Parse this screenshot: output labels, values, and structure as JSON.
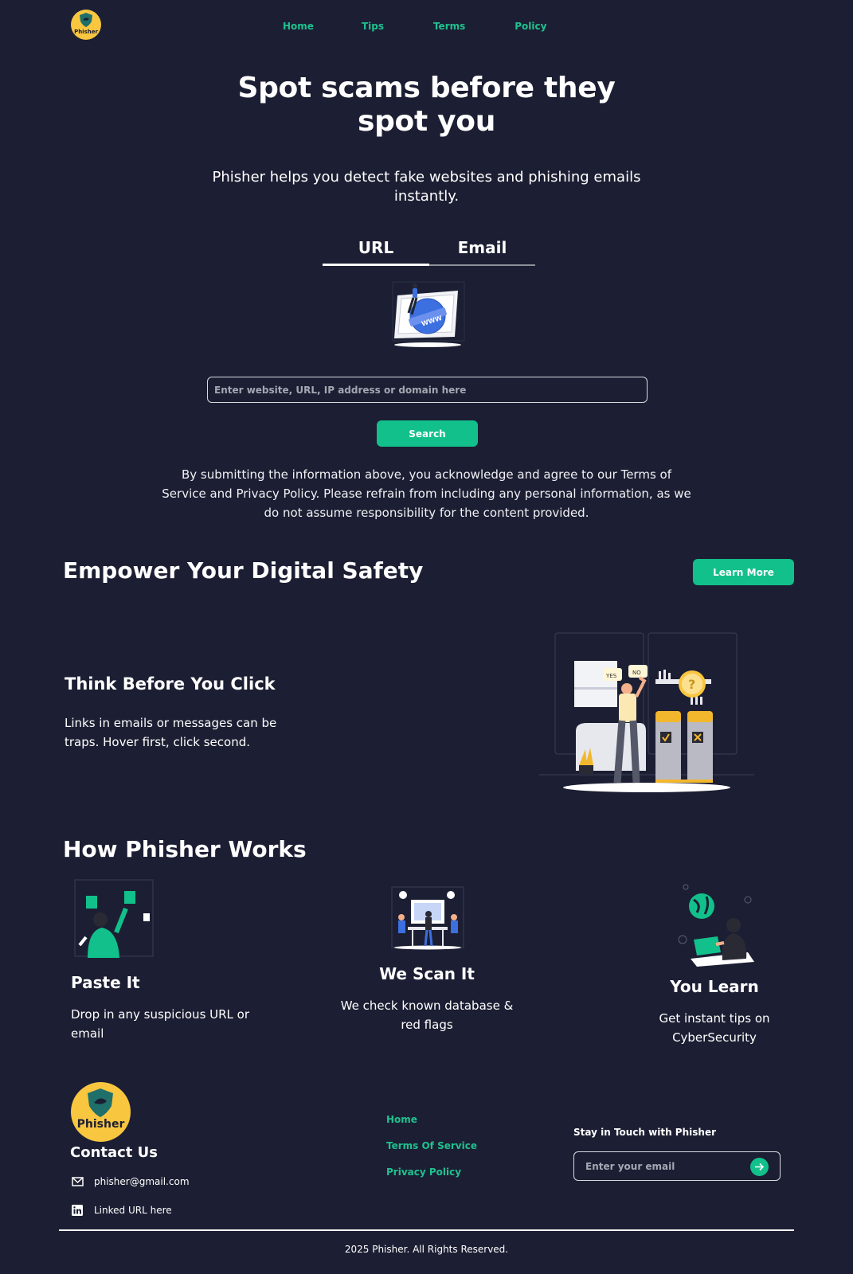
{
  "nav": {
    "logo_text": "Phisher",
    "links": [
      "Home",
      "Tips",
      "Terms",
      "Policy"
    ]
  },
  "hero": {
    "title_line1": "Spot scams before they",
    "title_line2": "spot you",
    "subtitle": "Phisher helps you detect fake websites and phishing emails instantly.",
    "tabs": [
      "URL",
      "Email"
    ],
    "search_placeholder": "Enter website, URL, IP address or domain here",
    "search_button": "Search",
    "disclaimer": "By submitting the information above, you acknowledge and agree to our Terms of Service and Privacy Policy. Please refrain from including any personal information, as we do not assume responsibility for the content provided."
  },
  "empower": {
    "title": "Empower Your Digital Safety",
    "learn_more": "Learn More",
    "card_title": "Think Before You Click",
    "card_text": "Links in emails or messages can be traps. Hover first, click second.",
    "illus_yes": "YES",
    "illus_no": "NO"
  },
  "how": {
    "title": "How Phisher Works",
    "steps": [
      {
        "title": "Paste It",
        "text": "Drop in any suspicious URL or email"
      },
      {
        "title": "We Scan It",
        "text": "We check known database & red flags"
      },
      {
        "title": "You Learn",
        "text": "Get instant tips on CyberSecurity"
      }
    ]
  },
  "footer": {
    "logo_text": "Phisher",
    "contact_title": "Contact Us",
    "email": "phisher@gmail.com",
    "linkedin": "Linked URL here",
    "links": [
      "Home",
      "Terms Of Service",
      "Privacy Policy"
    ],
    "newsletter_title": "Stay in Touch with Phisher",
    "newsletter_placeholder": "Enter your email",
    "copyright": "2025 Phisher. All Rights Reserved."
  },
  "colors": {
    "background": "#1c1f33",
    "accent": "#12c08b",
    "link": "#1fc18f",
    "logo": "#f9c640"
  }
}
